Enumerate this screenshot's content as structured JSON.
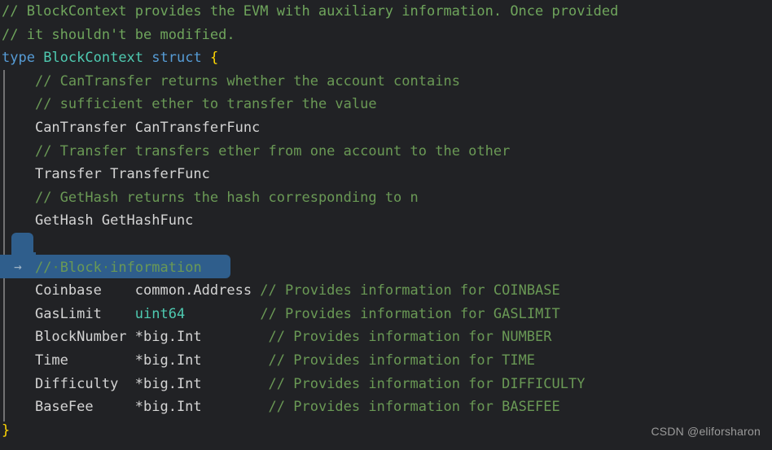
{
  "editor": {
    "language": "go",
    "theme": "dark-plus",
    "colors": {
      "background": "#212225",
      "comment": "#6A9955",
      "keyword": "#569CD6",
      "type": "#4EC9B0",
      "plain": "#D4D4D4",
      "brace": "#FFD602",
      "selection": "#2F5E8C",
      "indent_guide": "#8D8D8D",
      "watermark": "#9B9B9B"
    },
    "indent_guide_visible": true,
    "tab_arrow_glyph": "→",
    "whitespace_dot_glyph": "·"
  },
  "lines": [
    {
      "n": 1,
      "indent": 0,
      "segments": [
        {
          "cls": "cmt-top",
          "text": "// BlockContext provides the EVM with auxiliary information. Once provided"
        }
      ]
    },
    {
      "n": 2,
      "indent": 0,
      "segments": [
        {
          "cls": "cmt-top",
          "text": "// it shouldn't be modified."
        }
      ]
    },
    {
      "n": 3,
      "indent": 0,
      "segments": [
        {
          "cls": "kw",
          "text": "type"
        },
        {
          "cls": "plain",
          "text": " "
        },
        {
          "cls": "typ",
          "text": "BlockContext"
        },
        {
          "cls": "plain",
          "text": " "
        },
        {
          "cls": "kw",
          "text": "struct"
        },
        {
          "cls": "plain",
          "text": " "
        },
        {
          "cls": "brace",
          "text": "{"
        }
      ]
    },
    {
      "n": 4,
      "indent": 1,
      "segments": [
        {
          "cls": "cmt",
          "text": "// CanTransfer returns whether the account contains"
        }
      ]
    },
    {
      "n": 5,
      "indent": 1,
      "segments": [
        {
          "cls": "cmt",
          "text": "// sufficient ether to transfer the value"
        }
      ]
    },
    {
      "n": 6,
      "indent": 1,
      "segments": [
        {
          "cls": "plain",
          "text": "CanTransfer CanTransferFunc"
        }
      ]
    },
    {
      "n": 7,
      "indent": 1,
      "segments": [
        {
          "cls": "cmt",
          "text": "// Transfer transfers ether from one account to the other"
        }
      ]
    },
    {
      "n": 8,
      "indent": 1,
      "segments": [
        {
          "cls": "plain",
          "text": "Transfer TransferFunc"
        }
      ]
    },
    {
      "n": 9,
      "indent": 1,
      "segments": [
        {
          "cls": "cmt",
          "text": "// GetHash returns the hash corresponding to n"
        }
      ]
    },
    {
      "n": 10,
      "indent": 1,
      "segments": [
        {
          "cls": "plain",
          "text": "GetHash GetHashFunc"
        }
      ]
    },
    {
      "n": 11,
      "indent": 0,
      "segments": [
        {
          "cls": "plain",
          "text": ""
        }
      ]
    },
    {
      "n": 12,
      "indent": 1,
      "selected": true,
      "segments": [
        {
          "cls": "cmt",
          "text": "//"
        },
        {
          "cls": "ws-dot",
          "text": "·"
        },
        {
          "cls": "cmt",
          "text": "Block"
        },
        {
          "cls": "ws-dot",
          "text": "·"
        },
        {
          "cls": "cmt",
          "text": "information"
        }
      ]
    },
    {
      "n": 13,
      "indent": 1,
      "segments": [
        {
          "cls": "plain",
          "text": "Coinbase    common.Address "
        },
        {
          "cls": "cmt",
          "text": "// Provides information for COINBASE"
        }
      ]
    },
    {
      "n": 14,
      "indent": 1,
      "segments": [
        {
          "cls": "plain",
          "text": "GasLimit    "
        },
        {
          "cls": "typ",
          "text": "uint64"
        },
        {
          "cls": "plain",
          "text": "         "
        },
        {
          "cls": "cmt",
          "text": "// Provides information for GASLIMIT"
        }
      ]
    },
    {
      "n": 15,
      "indent": 1,
      "segments": [
        {
          "cls": "plain",
          "text": "BlockNumber *big.Int        "
        },
        {
          "cls": "cmt",
          "text": "// Provides information for NUMBER"
        }
      ]
    },
    {
      "n": 16,
      "indent": 1,
      "segments": [
        {
          "cls": "plain",
          "text": "Time        *big.Int        "
        },
        {
          "cls": "cmt",
          "text": "// Provides information for TIME"
        }
      ]
    },
    {
      "n": 17,
      "indent": 1,
      "segments": [
        {
          "cls": "plain",
          "text": "Difficulty  *big.Int        "
        },
        {
          "cls": "cmt",
          "text": "// Provides information for DIFFICULTY"
        }
      ]
    },
    {
      "n": 18,
      "indent": 1,
      "segments": [
        {
          "cls": "plain",
          "text": "BaseFee     *big.Int        "
        },
        {
          "cls": "cmt",
          "text": "// Provides information for BASEFEE"
        }
      ]
    },
    {
      "n": 19,
      "indent": 0,
      "segments": [
        {
          "cls": "brace",
          "text": "}"
        }
      ]
    }
  ],
  "watermark": {
    "text": "CSDN @eliforsharon"
  }
}
